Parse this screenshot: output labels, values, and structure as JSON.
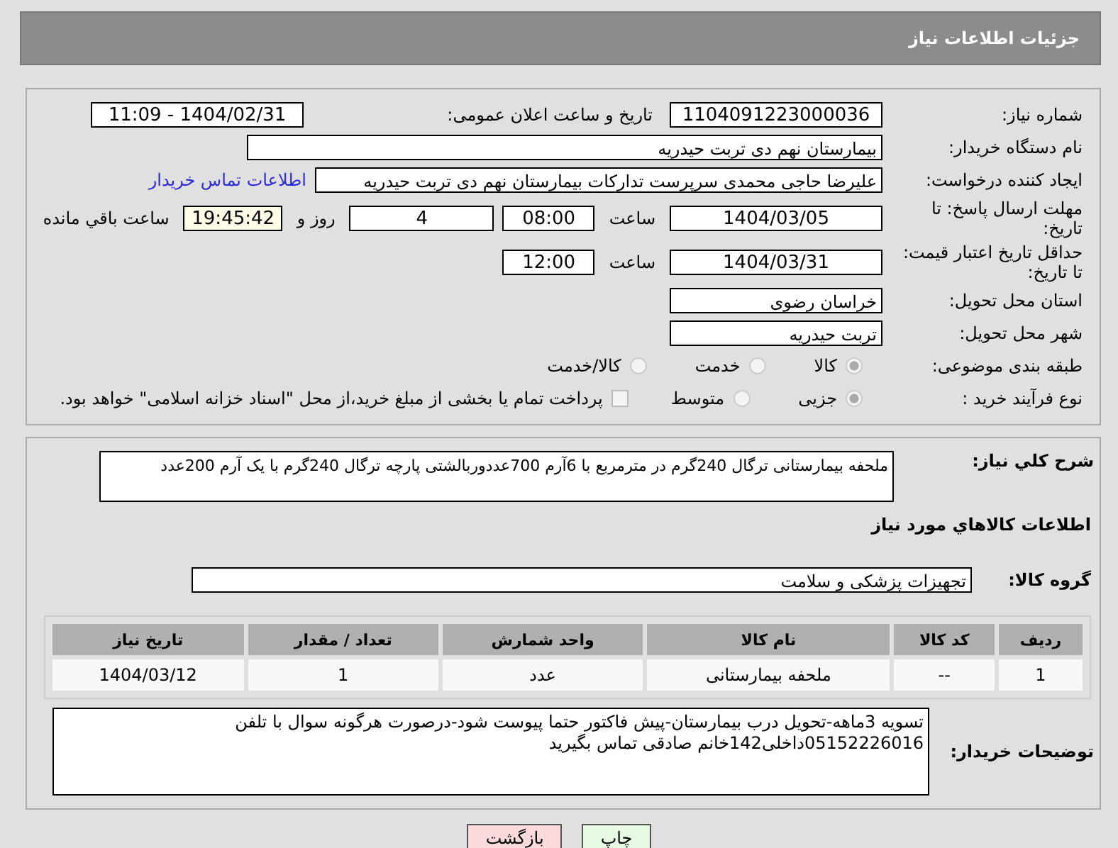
{
  "header": {
    "title": "جزئیات اطلاعات نیاز"
  },
  "need_number": {
    "label": "شماره نیاز:",
    "value": "1104091223000036"
  },
  "announce": {
    "label": "تاریخ و ساعت اعلان عمومی:",
    "value": "1404/02/31 - 11:09"
  },
  "buyer_org": {
    "label": "نام دستگاه خریدار:",
    "value": "بیمارستان نهم دی تربت حیدریه"
  },
  "requester": {
    "label": "ایجاد کننده درخواست:",
    "value": "علیرضا حاجی محمدی سرپرست تدارکات بیمارستان نهم دی تربت حیدریه",
    "link": "اطلاعات تماس خریدار"
  },
  "deadline": {
    "label": "مهلت ارسال پاسخ: تا تاریخ:",
    "date": "1404/03/05",
    "time_label": "ساعت",
    "time": "08:00",
    "days": "4",
    "days_label": "روز و",
    "remaining": "19:45:42",
    "remaining_label": "ساعت باقي مانده"
  },
  "validity": {
    "label": "حداقل تاریخ اعتبار قیمت: تا تاریخ:",
    "date": "1404/03/31",
    "time_label": "ساعت",
    "time": "12:00"
  },
  "province": {
    "label": "استان محل تحویل:",
    "value": "خراسان رضوی"
  },
  "city": {
    "label": "شهر محل تحویل:",
    "value": "تربت حیدریه"
  },
  "category": {
    "label": "طبقه بندی موضوعی:",
    "options": [
      {
        "label": "کالا",
        "selected": true
      },
      {
        "label": "خدمت",
        "selected": false
      },
      {
        "label": "کالا/خدمت",
        "selected": false
      }
    ]
  },
  "process": {
    "label": "نوع فرآیند خرید :",
    "options": [
      {
        "label": "جزیی",
        "selected": true
      },
      {
        "label": "متوسط",
        "selected": false
      }
    ],
    "payment": {
      "label": "پرداخت تمام یا بخشی از مبلغ خرید،از محل \"اسناد خزانه اسلامی\" خواهد بود.",
      "checked": false
    }
  },
  "description": {
    "label": "شرح كلي نياز:",
    "value": "ملحفه بیمارستانی ترگال 240گرم در مترمربع با 6آرم 700عددوربالشتی پارچه ترگال 240گرم با یک آرم 200عدد"
  },
  "goods_title": "اطلاعات كالاهاي مورد نياز",
  "goods_group": {
    "label": "گروه کالا:",
    "value": "تجهیزات پزشکی و سلامت"
  },
  "table": {
    "columns": [
      "ردیف",
      "کد کالا",
      "نام کالا",
      "واحد شمارش",
      "تعداد / مقدار",
      "تاریخ نیاز"
    ],
    "rows": [
      [
        "1",
        "--",
        "ملحفه بیمارستانی",
        "عدد",
        "1",
        "1404/03/12"
      ]
    ]
  },
  "buyer_notes": {
    "label": "توضیحات خریدار:",
    "value": "تسویه 3ماهه-تحویل درب بیمارستان-پیش فاکتور حتما پیوست شود-درصورت هرگونه سوال با تلفن 05152226016داخلی142خانم صادقی تماس بگیرید"
  },
  "buttons": [
    {
      "label": "چاپ",
      "kind": "print"
    },
    {
      "label": "بازگشت",
      "kind": "back"
    }
  ]
}
